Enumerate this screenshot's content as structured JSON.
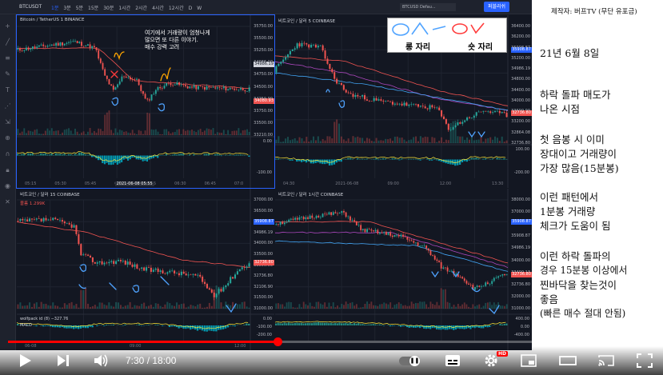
{
  "toolbar": {
    "symbol": "BTCUSDT",
    "timeframes": [
      "1분",
      "3분",
      "5분",
      "15분",
      "30분",
      "1시간",
      "2시간",
      "4시간",
      "12시간",
      "D",
      "W"
    ],
    "active_timeframe": "1분",
    "symbol2": "BTCUSD Defau...",
    "publish_label": "퍼블리쉬"
  },
  "panes": {
    "p1": {
      "title": "Bitcoin / TetherUS  1  BINANCE",
      "prices": [
        "35750.00",
        "35500.00",
        "35250.00",
        "34986.19",
        "34750.00",
        "34500.00",
        "34250.00",
        "33750.00",
        "33500.00",
        "33210.00"
      ],
      "tag_white": "34986.19",
      "tag_red": "34080.93",
      "times": [
        "05:15",
        "05:30",
        "05:45",
        "06:00",
        "06:15",
        "06:30",
        "06:45",
        "07:0"
      ],
      "highlight_time": "2021-06-08 05:55",
      "ind_ticks": [
        "0.00",
        "-100.00"
      ],
      "annotation": [
        "여기에서 거래량이 엄청나게",
        "많으면 또 다른 이야기.",
        "매수 강력 고려"
      ]
    },
    "p2": {
      "title": "비트코인 / 달러  5  COINBASE",
      "prices": [
        "36400.00",
        "36200.00",
        "35908.87",
        "35200.00",
        "34986.19",
        "34800.00",
        "34400.00",
        "34000.00",
        "33600.00",
        "33200.00",
        "32864.08",
        "32736.80"
      ],
      "tag_blue": "35908.87",
      "tag_red": "32736.80",
      "times": [
        "04:30",
        "2021-06-08",
        "09:00",
        "12:00",
        "13:30"
      ],
      "ind_ticks": [
        "100.00",
        "-200.00"
      ]
    },
    "p3": {
      "title": "비트코인 / 달러  15  COINBASE",
      "sub": "볼륨  1.299K",
      "prices": [
        "37000.00",
        "36500.00",
        "35908.87",
        "34986.19",
        "34000.00",
        "33500.00",
        "33000.00",
        "32736.80",
        "32106.90",
        "31500.00",
        "31000.00"
      ],
      "tag_blue": "35908.87",
      "tag_red": "32736.80",
      "ind_label": "wolfpack id (8)  −327.76",
      "ind_label2": "MACD",
      "ind_ticks": [
        "0.00",
        "-100.00",
        "-200.00"
      ],
      "times": [
        "06-08",
        "09:00",
        "12:00"
      ]
    },
    "p4": {
      "title": "비트코인 / 달러  1시간  COINBASE",
      "prices": [
        "38000.00",
        "37000.00",
        "36000.00",
        "35908.87",
        "34986.19",
        "34000.00",
        "33400.13",
        "32736.80",
        "32000.00",
        "31000.00"
      ],
      "tag_blue": "35908.87",
      "tag_red": "32736.80",
      "ind_ticks": [
        "400.00",
        "0.00",
        "-400.00"
      ]
    }
  },
  "legend": {
    "long_label": "롱 자리",
    "short_label": "숏 자리"
  },
  "notes": {
    "credit": "제작자: 버프TV (무단 유포금)",
    "lines": [
      "21년 6월 8일",
      "하락 돌파 매도가",
      "나온 시점",
      "첫 음봉 시 이미",
      "장대이고 거래량이",
      "가장 많음(15분봉)",
      "이런 패턴에서",
      "1분봉 거래량",
      "체크가 도움이 됨",
      "이런 하락 돌파의",
      "경우 15분봉 이상에서",
      "찐바닥을 찾는것이",
      "좋음",
      "(빠른 매수 절대 안됨)"
    ]
  },
  "player": {
    "time_display": "7:30 / 18:00",
    "progress": 0.4167,
    "autoplay_on": true,
    "hd_badge": "HD"
  },
  "colors": {
    "up": "#26a69a",
    "down": "#ef5350",
    "annotation_blue": "#4fa3ff",
    "annotation_orange": "#ffa500",
    "annotation_red": "#ff3b3b",
    "accent": "#2962ff",
    "progress": "#ff0000"
  }
}
